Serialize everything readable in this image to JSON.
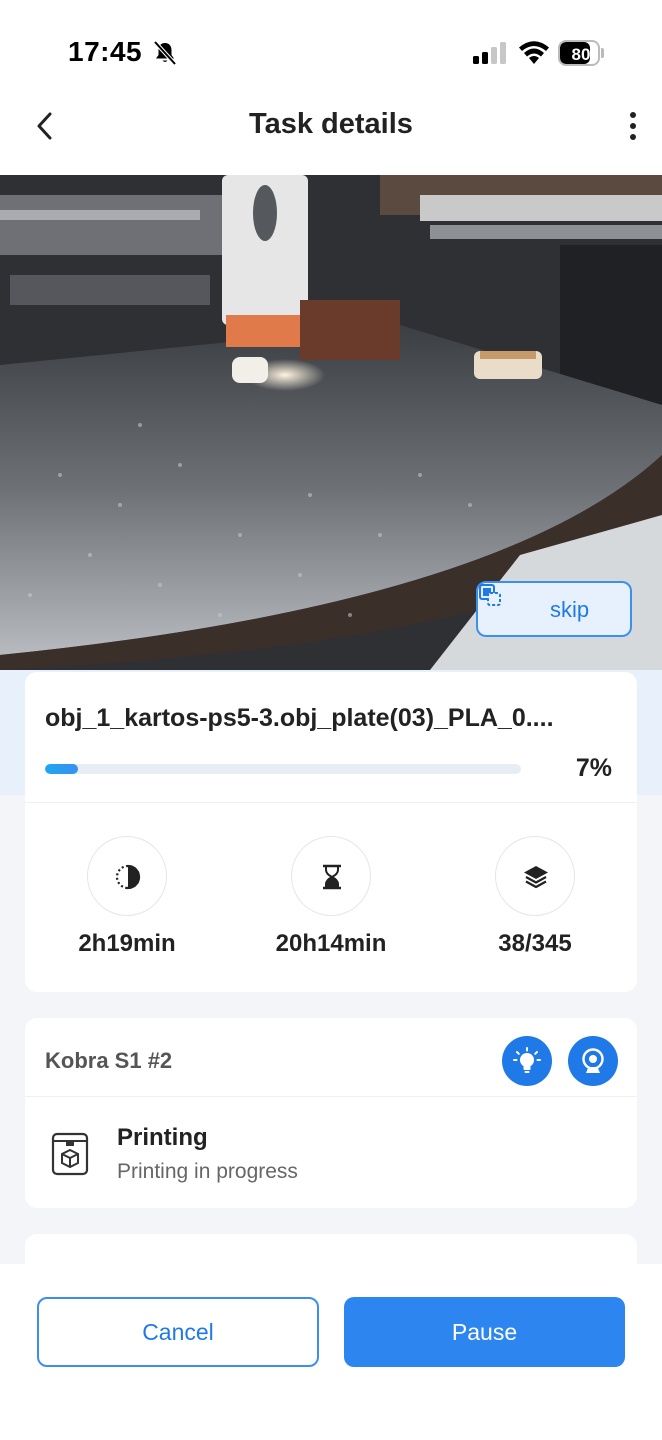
{
  "status_bar": {
    "time": "17:45",
    "battery": "80",
    "battery_level": 0.8,
    "icons": [
      "bell-slash-icon",
      "cellular-signal-icon",
      "wifi-icon",
      "battery-icon"
    ]
  },
  "header": {
    "title": "Task details",
    "back_icon": "chevron-left-icon",
    "more_icon": "more-vertical-icon"
  },
  "camera": {
    "skip_label": "skip",
    "skip_icon": "skip-object-icon"
  },
  "job": {
    "file_name": "obj_1_kartos-ps5-3.obj_plate(03)_PLA_0....",
    "progress_label": "7%",
    "progress": 0.07
  },
  "stats": [
    {
      "icon": "elapsed-time-icon",
      "value": "2h19min"
    },
    {
      "icon": "hourglass-icon",
      "value": "20h14min"
    },
    {
      "icon": "layers-icon",
      "value": "38/345"
    }
  ],
  "printer": {
    "name": "Kobra S1 #2",
    "light_icon": "lightbulb-icon",
    "camera_icon": "webcam-icon",
    "status_icon": "printer-icon",
    "status_title": "Printing",
    "status_subtitle": "Printing in progress"
  },
  "actions": {
    "cancel_label": "Cancel",
    "pause_label": "Pause"
  },
  "colors": {
    "accent": "#2d86f0",
    "accent_light": "#e6f1fd",
    "background": "#f3f5f8"
  }
}
